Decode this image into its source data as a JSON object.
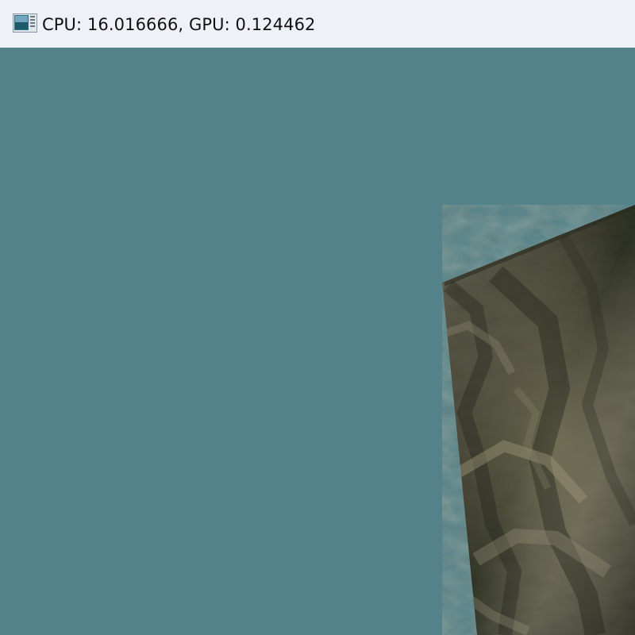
{
  "window": {
    "title": "CPU: 16.016666, GPU: 0.124462",
    "icon": "application-window-icon"
  },
  "scene": {
    "background_color": "#54828a",
    "object": "rock-textured-cube"
  }
}
